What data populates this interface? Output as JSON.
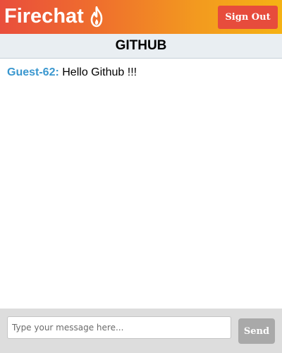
{
  "header": {
    "app_name": "Firechat",
    "logo_icon": "flame-icon",
    "signout_label": "Sign Out"
  },
  "room": {
    "name": "GITHUB"
  },
  "messages": [
    {
      "user": "Guest-62:",
      "text": "Hello Github !!!"
    }
  ],
  "composer": {
    "placeholder": "Type your message here...",
    "send_label": "Send"
  },
  "colors": {
    "header_gradient_start": "#e94e3c",
    "header_gradient_end": "#f5b214",
    "signout_bg": "#e74c3c",
    "username": "#3a97cf",
    "send_bg": "#a9a9a9"
  }
}
